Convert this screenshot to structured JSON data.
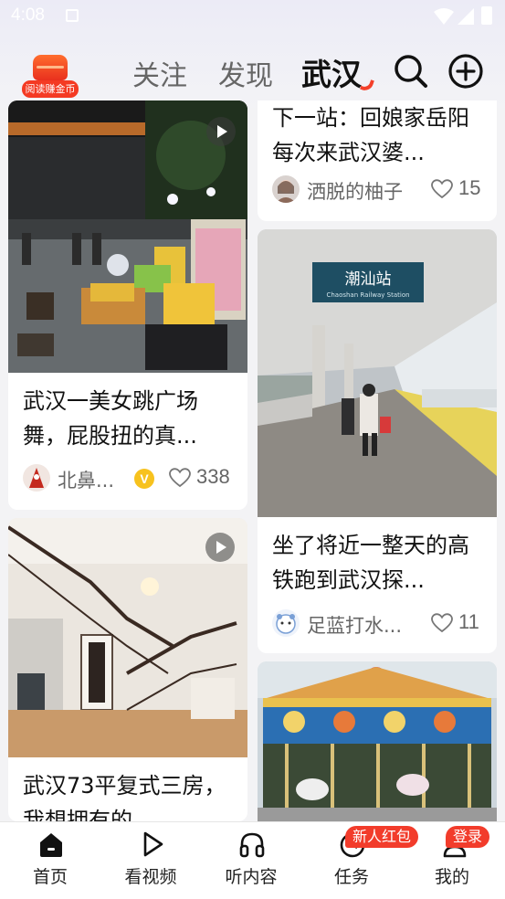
{
  "status_bar": {
    "time": "4:08"
  },
  "header": {
    "coin_badge_label": "阅读赚金币",
    "tabs": [
      {
        "label": "关注"
      },
      {
        "label": "发现"
      },
      {
        "label": "武汉"
      }
    ],
    "active_tab": "武汉"
  },
  "feed": {
    "left": [
      {
        "title": "武汉一美女跳广场舞，屁股扭的真...",
        "author": "北鼻...",
        "verified": true,
        "verified_label": "V",
        "likes": "338",
        "video": true
      },
      {
        "title": "武汉73平复式三房，我想拥有的",
        "video": true
      }
    ],
    "right": [
      {
        "title": "下一站：回娘家岳阳 每次来武汉婆...",
        "author": "洒脱的柚子",
        "likes": "15"
      },
      {
        "title": "坐了将近一整天的高铁跑到武汉探...",
        "author": "足蓝打水...",
        "likes": "11",
        "image_sign": "潮汕站",
        "image_sign_en": "Chaoshan Railway Station"
      },
      {
        "title": ""
      }
    ]
  },
  "bottom_nav": {
    "items": [
      {
        "label": "首页",
        "icon": "home-icon",
        "active": true
      },
      {
        "label": "看视频",
        "icon": "play-circle-icon"
      },
      {
        "label": "听内容",
        "icon": "headphones-icon"
      },
      {
        "label": "任务",
        "icon": "task-clock-icon",
        "badge": "新人红包"
      },
      {
        "label": "我的",
        "icon": "profile-icon",
        "badge": "登录"
      }
    ]
  },
  "colors": {
    "accent": "#f4402a",
    "background": "#f3f3f5",
    "card": "#ffffff"
  }
}
